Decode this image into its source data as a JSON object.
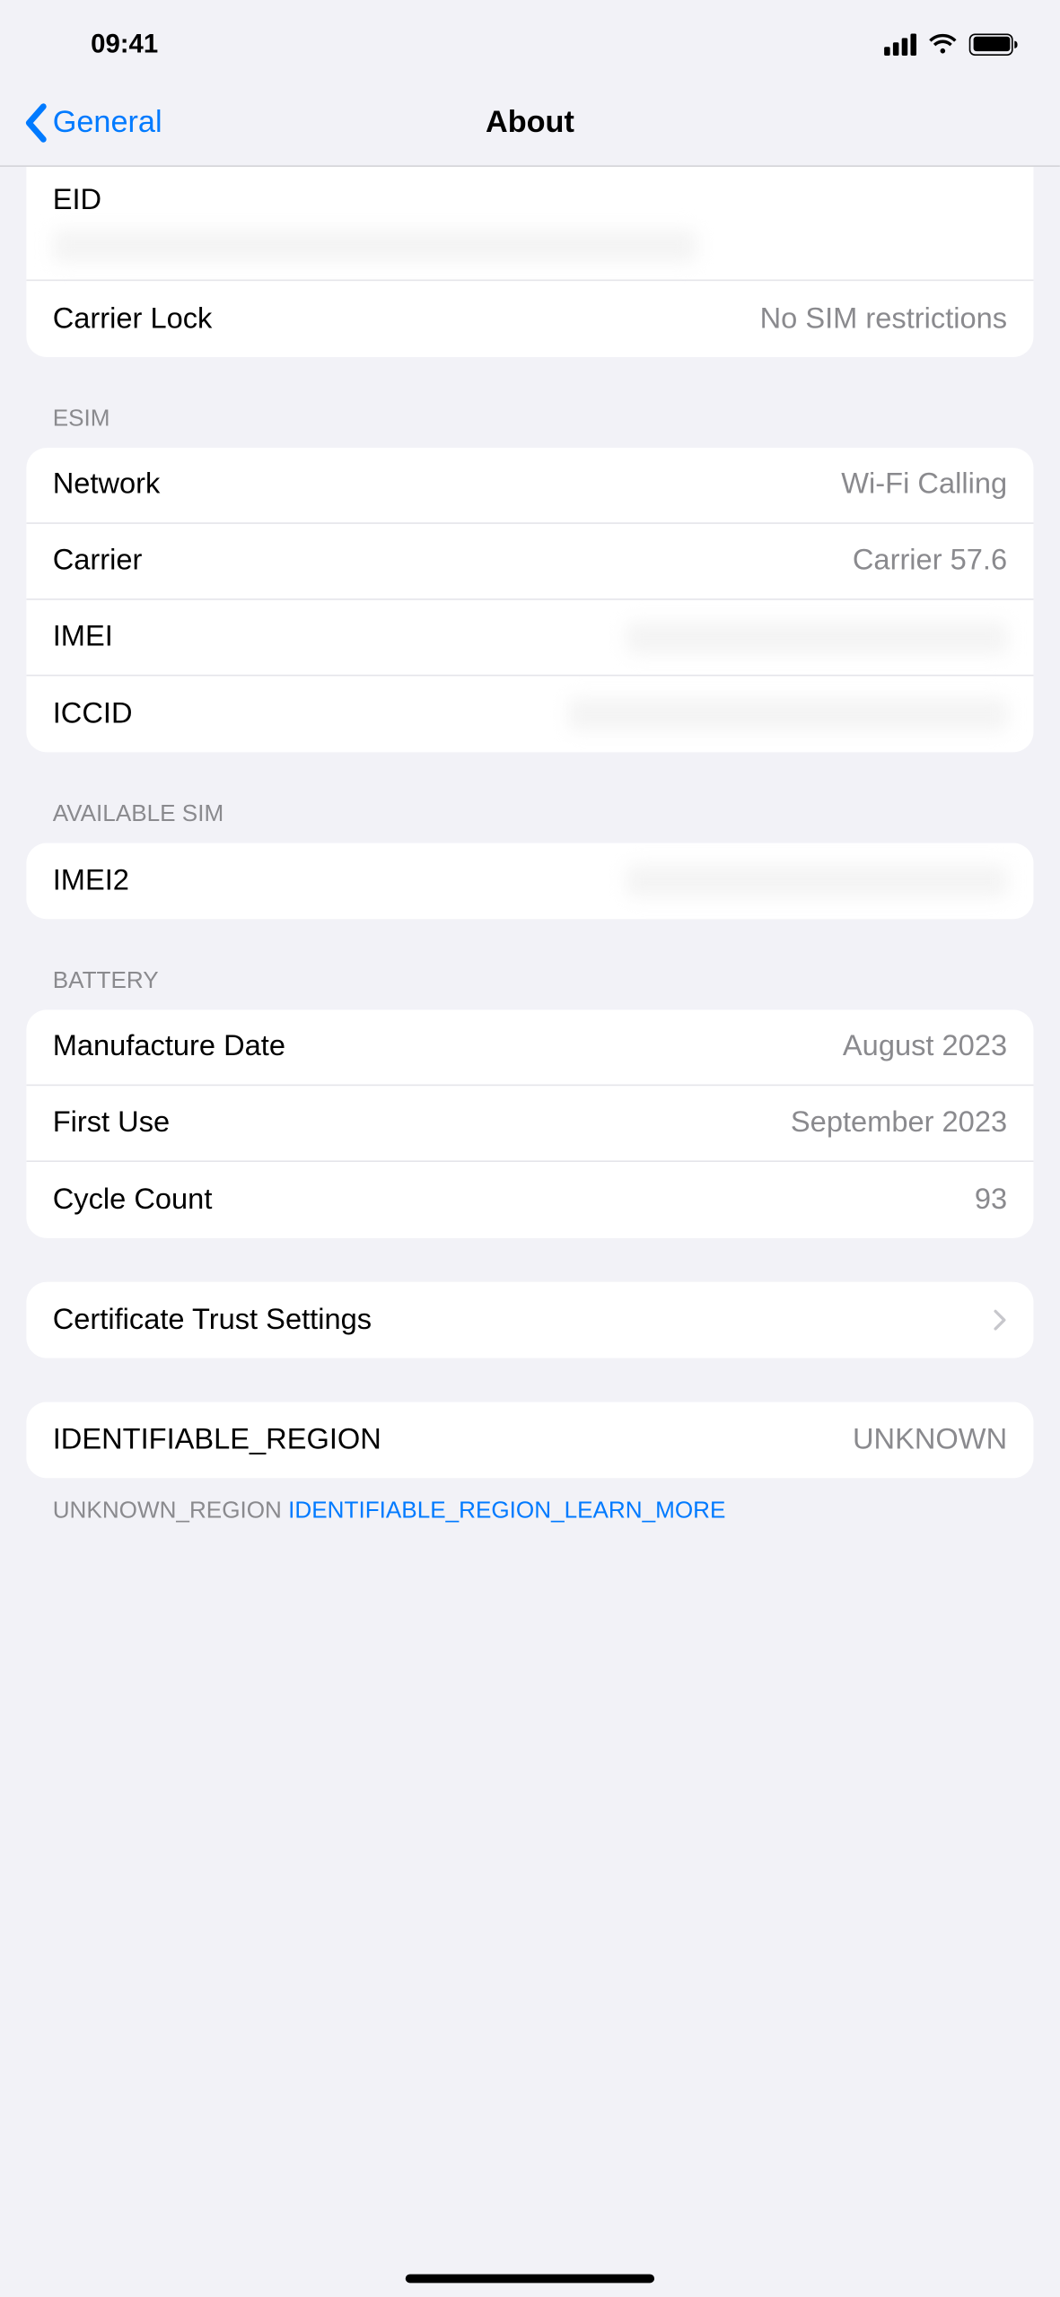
{
  "status": {
    "time": "09:41"
  },
  "nav": {
    "back": "General",
    "title": "About"
  },
  "eid": {
    "label": "EID",
    "value": "REDACTED"
  },
  "carrier_lock": {
    "label": "Carrier Lock",
    "value": "No SIM restrictions"
  },
  "esim_header": "ESIM",
  "esim": {
    "network": {
      "label": "Network",
      "value": "Wi-Fi Calling"
    },
    "carrier": {
      "label": "Carrier",
      "value": "Carrier 57.6"
    },
    "imei": {
      "label": "IMEI",
      "value": "REDACTED"
    },
    "iccid": {
      "label": "ICCID",
      "value": "REDACTED"
    }
  },
  "available_header": "AVAILABLE SIM",
  "available": {
    "imei2": {
      "label": "IMEI2",
      "value": "REDACTED"
    }
  },
  "battery_header": "BATTERY",
  "battery": {
    "manufacture": {
      "label": "Manufacture Date",
      "value": "August 2023"
    },
    "first_use": {
      "label": "First Use",
      "value": "September 2023"
    },
    "cycle": {
      "label": "Cycle Count",
      "value": "93"
    }
  },
  "cert": {
    "label": "Certificate Trust Settings"
  },
  "region": {
    "label": "IDENTIFIABLE_REGION",
    "value": "UNKNOWN"
  },
  "footer": {
    "prefix": "UNKNOWN_REGION ",
    "link": "IDENTIFIABLE_REGION_LEARN_MORE"
  }
}
